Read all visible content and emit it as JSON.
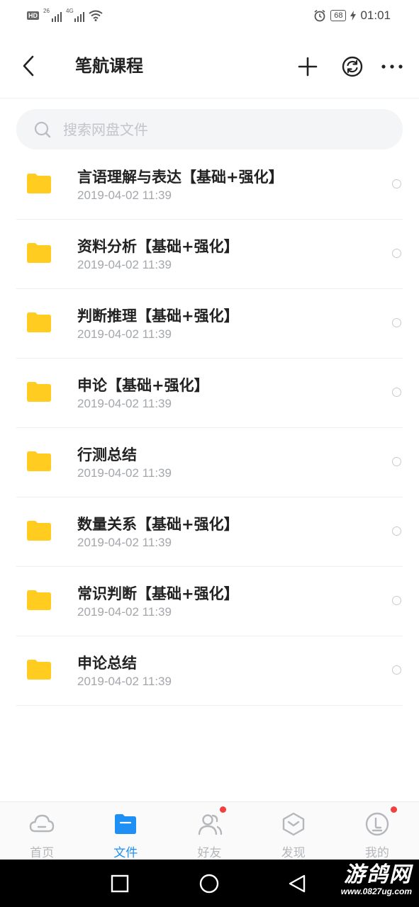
{
  "status_bar": {
    "badge": "HD",
    "net1": "26",
    "net2": "4G",
    "battery": "68",
    "time": "01:01"
  },
  "header": {
    "title": "笔航课程",
    "icons": [
      "back-arrow-icon",
      "plus-icon",
      "refresh-icon",
      "more-icon"
    ]
  },
  "search": {
    "placeholder": "搜索网盘文件",
    "value": ""
  },
  "files": [
    {
      "name": "言语理解与表达【基础+强化】",
      "date": "2019-04-02  11:39"
    },
    {
      "name": "资料分析【基础+强化】",
      "date": "2019-04-02  11:39"
    },
    {
      "name": "判断推理【基础+强化】",
      "date": "2019-04-02  11:39"
    },
    {
      "name": "申论【基础+强化】",
      "date": "2019-04-02  11:39"
    },
    {
      "name": "行测总结",
      "date": "2019-04-02  11:39"
    },
    {
      "name": "数量关系【基础+强化】",
      "date": "2019-04-02  11:39"
    },
    {
      "name": "常识判断【基础+强化】",
      "date": "2019-04-02  11:39"
    },
    {
      "name": "申论总结",
      "date": "2019-04-02  11:39"
    }
  ],
  "bottom_nav": [
    {
      "label": "首页",
      "icon": "cloud-icon",
      "active": false,
      "badge": false
    },
    {
      "label": "文件",
      "icon": "folder-icon",
      "active": true,
      "badge": false
    },
    {
      "label": "好友",
      "icon": "friends-icon",
      "active": false,
      "badge": true
    },
    {
      "label": "发现",
      "icon": "discover-icon",
      "active": false,
      "badge": false
    },
    {
      "label": "我的",
      "icon": "profile-icon",
      "active": false,
      "badge": true
    }
  ],
  "colors": {
    "accent": "#1e8ff5",
    "folder": "#ffcc1f",
    "badge": "#f04040"
  },
  "watermark": {
    "main": "游鸽网",
    "sub": "www.0827ug.com"
  }
}
